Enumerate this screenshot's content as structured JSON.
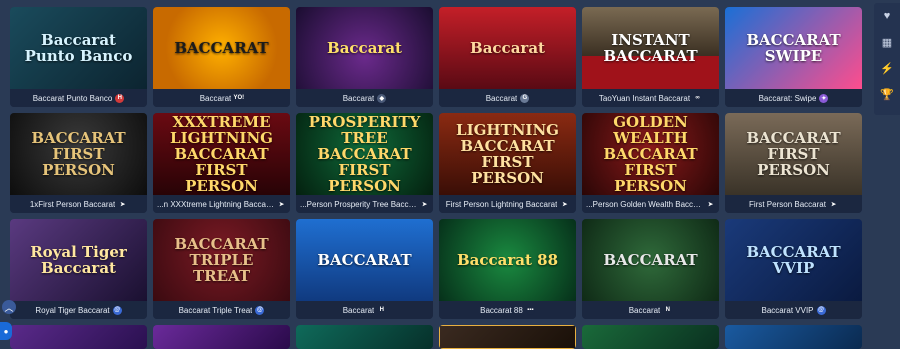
{
  "games": [
    {
      "thumb_title": "Baccarat Punto Banco",
      "caption": "Baccarat Punto Banco",
      "provider_icon": "provider-red-logo-icon",
      "provider_color": "#d23a3a",
      "provider_glyph": "H"
    },
    {
      "thumb_title": "BACCARAT",
      "caption": "Baccarat",
      "provider_icon": "provider-yo-logo-icon",
      "provider_color": "#1b2740",
      "provider_glyph": "YO!"
    },
    {
      "thumb_title": "Baccarat",
      "caption": "Baccarat",
      "provider_icon": "provider-shield-logo-icon",
      "provider_color": "#4a5a78",
      "provider_glyph": "◆"
    },
    {
      "thumb_title": "Baccarat",
      "caption": "Baccarat",
      "provider_icon": "provider-g-logo-icon",
      "provider_color": "#6a7a96",
      "provider_glyph": "G"
    },
    {
      "thumb_title": "INSTANT BACCARAT",
      "caption": "TaoYuan Instant Baccarat",
      "provider_icon": "provider-infinity-logo-icon",
      "provider_color": "#1b2740",
      "provider_glyph": "∞"
    },
    {
      "thumb_title": "BACCARAT SWIPE",
      "caption": "Baccarat: Swipe",
      "provider_icon": "provider-gem-logo-icon",
      "provider_color": "#8a5ad6",
      "provider_glyph": "✦"
    },
    {
      "thumb_title": "BACCARAT FIRST PERSON",
      "caption": "1xFirst Person Baccarat",
      "provider_icon": "provider-arrow-logo-icon",
      "provider_color": "#1b2740",
      "provider_glyph": "➤"
    },
    {
      "thumb_title": "XXXTREME LIGHTNING BACCARAT FIRST PERSON",
      "caption": "...n XXXtreme Lightning Baccarat",
      "provider_icon": "provider-arrow-logo-icon",
      "provider_color": "#1b2740",
      "provider_glyph": "➤"
    },
    {
      "thumb_title": "PROSPERITY TREE BACCARAT FIRST PERSON",
      "caption": "...Person Prosperity Tree Baccarat",
      "provider_icon": "provider-arrow-logo-icon",
      "provider_color": "#1b2740",
      "provider_glyph": "➤"
    },
    {
      "thumb_title": "LIGHTNING BACCARAT FIRST PERSON",
      "caption": "First Person Lightning Baccarat",
      "provider_icon": "provider-arrow-logo-icon",
      "provider_color": "#1b2740",
      "provider_glyph": "➤"
    },
    {
      "thumb_title": "GOLDEN WEALTH BACCARAT FIRST PERSON",
      "caption": "...Person Golden Wealth Baccarat",
      "provider_icon": "provider-arrow-logo-icon",
      "provider_color": "#1b2740",
      "provider_glyph": "➤"
    },
    {
      "thumb_title": "BACCARAT FIRST PERSON",
      "caption": "First Person Baccarat",
      "provider_icon": "provider-arrow-logo-icon",
      "provider_color": "#1b2740",
      "provider_glyph": "➤"
    },
    {
      "thumb_title": "Royal Tiger Baccarat",
      "caption": "Royal Tiger Baccarat",
      "provider_icon": "provider-swirl-logo-icon",
      "provider_color": "#3a6ad6",
      "provider_glyph": "@"
    },
    {
      "thumb_title": "BACCARAT TRIPLE TREAT",
      "caption": "Baccarat Triple Treat",
      "provider_icon": "provider-swirl-logo-icon",
      "provider_color": "#3a6ad6",
      "provider_glyph": "@"
    },
    {
      "thumb_title": "BACCARAT",
      "caption": "Baccarat",
      "provider_icon": "provider-h-logo-icon",
      "provider_color": "#1b2740",
      "provider_glyph": "H"
    },
    {
      "thumb_title": "Baccarat 88",
      "caption": "Baccarat 88",
      "provider_icon": "provider-box-logo-icon",
      "provider_color": "#1b2740",
      "provider_glyph": "▪▪▪"
    },
    {
      "thumb_title": "BACCARAT",
      "caption": "Baccarat",
      "provider_icon": "provider-ne-logo-icon",
      "provider_color": "#1b2740",
      "provider_glyph": "N"
    },
    {
      "thumb_title": "BACCARAT VVIP",
      "caption": "Baccarat VVIP",
      "provider_icon": "provider-swirl-logo-icon",
      "provider_color": "#3a6ad6",
      "provider_glyph": "@"
    },
    {
      "thumb_title": "",
      "caption": "",
      "provider_icon": "",
      "provider_color": "",
      "provider_glyph": ""
    },
    {
      "thumb_title": "",
      "caption": "",
      "provider_icon": "",
      "provider_color": "",
      "provider_glyph": ""
    },
    {
      "thumb_title": "",
      "caption": "",
      "provider_icon": "",
      "provider_color": "",
      "provider_glyph": ""
    },
    {
      "thumb_title": "",
      "caption": "",
      "provider_icon": "",
      "provider_color": "",
      "provider_glyph": ""
    },
    {
      "thumb_title": "",
      "caption": "",
      "provider_icon": "",
      "provider_color": "",
      "provider_glyph": ""
    },
    {
      "thumb_title": "",
      "caption": "",
      "provider_icon": "",
      "provider_color": "",
      "provider_glyph": ""
    }
  ],
  "rail": [
    {
      "icon": "heart-icon",
      "glyph": "♥"
    },
    {
      "icon": "grid-icon",
      "glyph": "▦"
    },
    {
      "icon": "lightning-icon",
      "glyph": "⚡"
    },
    {
      "icon": "trophy-icon",
      "glyph": "🏆"
    }
  ],
  "side": {
    "arrow_glyph": "︿",
    "chat_glyph": "●"
  }
}
